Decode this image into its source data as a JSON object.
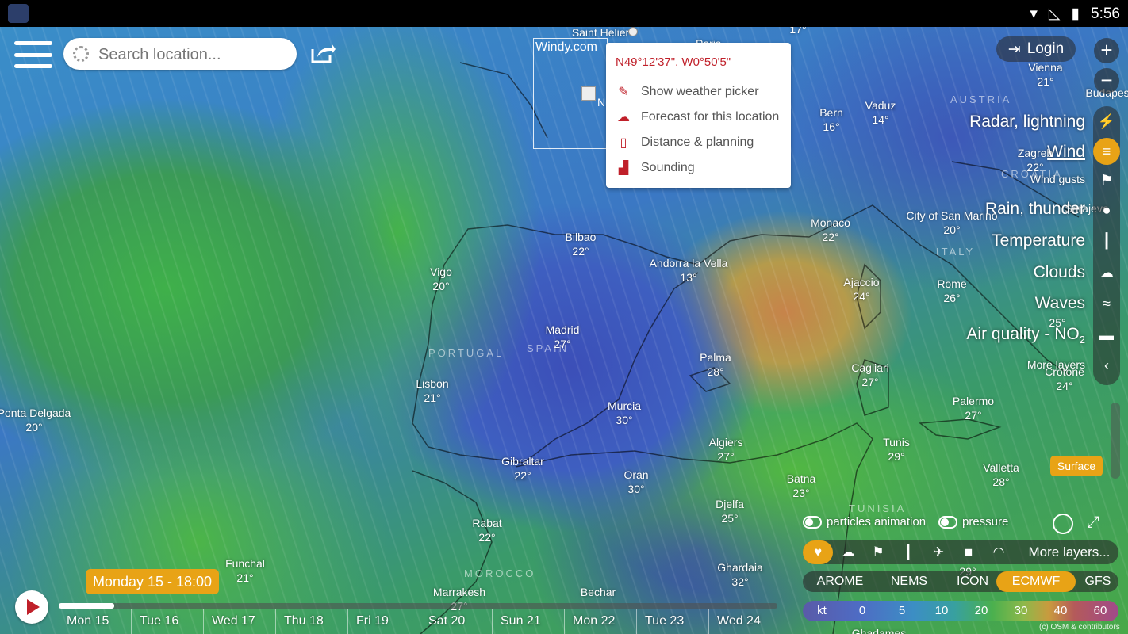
{
  "status_bar": {
    "time": "5:56",
    "icons": [
      "app-icon",
      "wifi-icon",
      "no-signal-icon",
      "battery-icon"
    ]
  },
  "search": {
    "placeholder": "Search location..."
  },
  "minimap": {
    "label": "Windy.com",
    "partial_text": "N"
  },
  "popup": {
    "coords": "N49°12'37\", W0°50'5\"",
    "items": [
      {
        "label": "Show weather picker",
        "icon": "picker-icon"
      },
      {
        "label": "Forecast for this location",
        "icon": "forecast-icon"
      },
      {
        "label": "Distance & planning",
        "icon": "ruler-icon"
      },
      {
        "label": "Sounding",
        "icon": "sounding-icon"
      }
    ]
  },
  "login": {
    "label": "Login"
  },
  "zoom": {
    "plus": "+",
    "minus": "−"
  },
  "layers": [
    {
      "label": "Radar, lightning",
      "icon": "radar-icon"
    },
    {
      "label": "Wind",
      "icon": "wind-icon",
      "active": true
    },
    {
      "label": "Wind gusts",
      "icon": "flag-icon"
    },
    {
      "label": "Rain, thunder",
      "icon": "drop-icon"
    },
    {
      "label": "Temperature",
      "icon": "thermometer-icon"
    },
    {
      "label": "Clouds",
      "icon": "cloud-icon"
    },
    {
      "label": "Waves",
      "icon": "waves-icon"
    },
    {
      "label": "Air quality - NO",
      "sub": "2",
      "icon": "car-icon"
    },
    {
      "label": "More layers",
      "icon": "chevron-left-icon"
    }
  ],
  "surface_label": "Surface",
  "toggles": {
    "particles": "particles animation",
    "pressure": "pressure"
  },
  "favorites": {
    "more": "More layers..."
  },
  "models": [
    "AROME",
    "NEMS",
    "ICON",
    "ECMWF",
    "GFS"
  ],
  "active_model": "ECMWF",
  "legend": {
    "unit": "kt",
    "values": [
      "0",
      "5",
      "10",
      "20",
      "30",
      "40",
      "60"
    ]
  },
  "timeline": {
    "current": "Monday 15 - 18:00",
    "days": [
      "Mon 15",
      "Tue 16",
      "Wed 17",
      "Thu 18",
      "Fri 19",
      "Sat 20",
      "Sun 21",
      "Mon 22",
      "Tue 23",
      "Wed 24"
    ]
  },
  "attribution": "(c) OSM & contributors",
  "countries": {
    "portugal": "PORTUGAL",
    "spain": "SPAIN",
    "morocco": "MOROCCO",
    "italy": "ITALY",
    "austria": "AUSTRIA",
    "croatia": "CROATIA",
    "tunisia": "TUNISIA"
  },
  "cities": [
    {
      "name": "Saint Helier",
      "temp": ""
    },
    {
      "name": "Paris",
      "temp": ""
    },
    {
      "name": "Vienna",
      "temp": "21°"
    },
    {
      "name": "Budapest",
      "temp": ""
    },
    {
      "name": "Bern",
      "temp": "16°"
    },
    {
      "name": "Vaduz",
      "temp": "14°"
    },
    {
      "name": "Zagreb",
      "temp": "22°"
    },
    {
      "name": "Sarajevo",
      "temp": ""
    },
    {
      "name": "Bilbao",
      "temp": "22°"
    },
    {
      "name": "Andorra la Vella",
      "temp": "13°"
    },
    {
      "name": "Monaco",
      "temp": "22°"
    },
    {
      "name": "City of San Marino",
      "temp": "20°"
    },
    {
      "name": "Vigo",
      "temp": "20°"
    },
    {
      "name": "Ajaccio",
      "temp": "24°"
    },
    {
      "name": "Rome",
      "temp": "26°"
    },
    {
      "name": "Madrid",
      "temp": "27°"
    },
    {
      "name": "Lisbon",
      "temp": "21°"
    },
    {
      "name": "Palma",
      "temp": "28°"
    },
    {
      "name": "Cagliari",
      "temp": "27°"
    },
    {
      "name": "Crotone",
      "temp": "24°"
    },
    {
      "name": "Ponta Delgada",
      "temp": "20°"
    },
    {
      "name": "Murcia",
      "temp": "30°"
    },
    {
      "name": "Palermo",
      "temp": "27°"
    },
    {
      "name": "Algiers",
      "temp": "27°"
    },
    {
      "name": "Tunis",
      "temp": "29°"
    },
    {
      "name": "Gibraltar",
      "temp": "22°"
    },
    {
      "name": "Oran",
      "temp": "30°"
    },
    {
      "name": "Valletta",
      "temp": "28°"
    },
    {
      "name": "Batna",
      "temp": "23°"
    },
    {
      "name": "Rabat",
      "temp": "22°"
    },
    {
      "name": "Djelfa",
      "temp": "25°"
    },
    {
      "name": "Funchal",
      "temp": "21°"
    },
    {
      "name": "Ghardaia",
      "temp": "32°"
    },
    {
      "name": "Marrakesh",
      "temp": "27°"
    },
    {
      "name": "Bechar",
      "temp": ""
    },
    {
      "name": "Ghadames",
      "temp": ""
    }
  ],
  "map_temps": {
    "top": "17°",
    "waves": "25°",
    "lower_right": "29°"
  }
}
